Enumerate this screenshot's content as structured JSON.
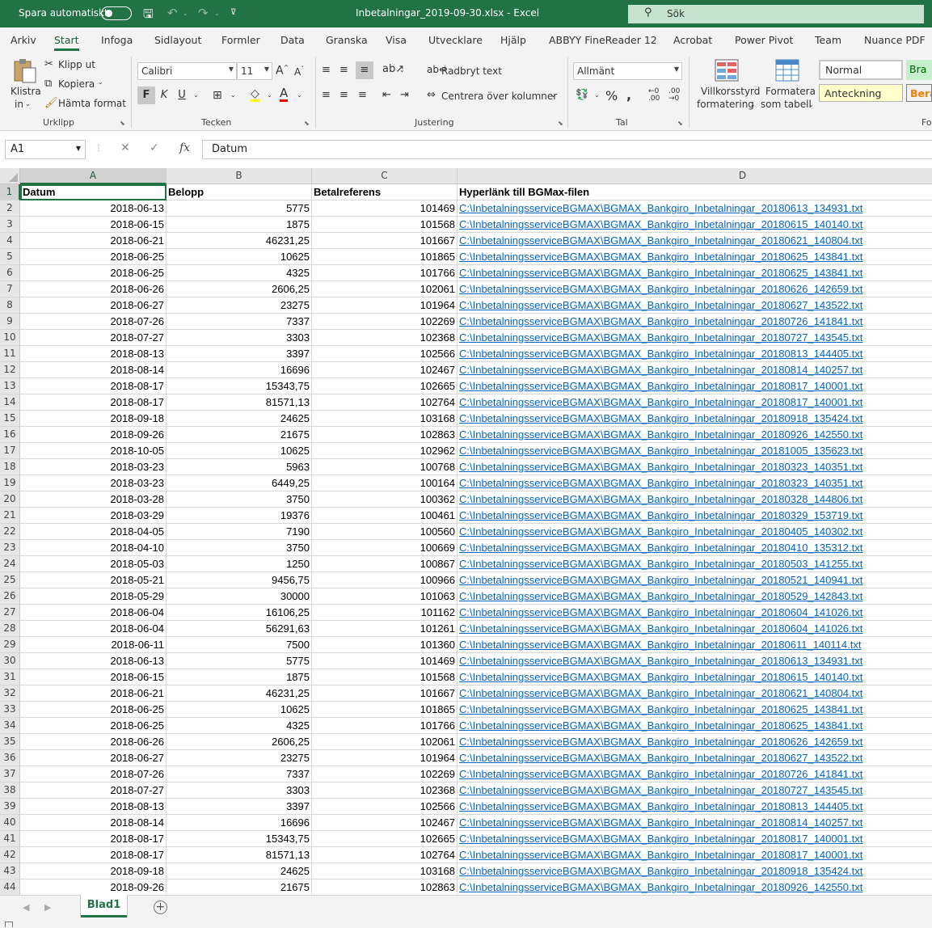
{
  "titlebar": {
    "autosave_label": "Spara automatiskt",
    "window_title": "Inbetalningar_2019-09-30.xlsx  -  Excel",
    "search_label": "Sök"
  },
  "tabs": [
    "Arkiv",
    "Start",
    "Infoga",
    "Sidlayout",
    "Formler",
    "Data",
    "Granska",
    "Visa",
    "Utvecklare",
    "Hjälp",
    "ABBYY FineReader 12",
    "Acrobat",
    "Power Pivot",
    "Team",
    "Nuance PDF"
  ],
  "ribbon": {
    "clipboard": {
      "paste_line1": "Klistra",
      "paste_line2": "in",
      "cut": "Klipp ut",
      "copy": "Kopiera",
      "format_painter": "Hämta format",
      "group": "Urklipp"
    },
    "font": {
      "name": "Calibri",
      "size": "11",
      "bold": "F",
      "italic": "K",
      "underline": "U",
      "group": "Tecken"
    },
    "alignment": {
      "wrap": "Radbryt text",
      "merge": "Centrera över kolumner",
      "group": "Justering"
    },
    "number": {
      "format": "Allmänt",
      "group": "Tal"
    },
    "styles": {
      "conditional_line1": "Villkorsstyrd",
      "conditional_line2": "formatering",
      "table_line1": "Formatera",
      "table_line2": "som tabell",
      "normal": "Normal",
      "good": "Bra",
      "note": "Anteckning",
      "calc": "Beräkning",
      "group": "Fo"
    }
  },
  "formula_bar": {
    "name_box": "A1",
    "fx": "fx",
    "content": "Datum"
  },
  "columns": [
    "A",
    "B",
    "C",
    "D"
  ],
  "header_row": [
    "Datum",
    "Belopp",
    "Betalreferens",
    "Hyperlänk till BGMax-filen"
  ],
  "rows": [
    [
      "2018-06-13",
      "5775",
      "101469",
      "C:\\InbetalningsserviceBGMAX\\BGMAX_Bankgiro_Inbetalningar_20180613_134931.txt"
    ],
    [
      "2018-06-15",
      "1875",
      "101568",
      "C:\\InbetalningsserviceBGMAX\\BGMAX_Bankgiro_Inbetalningar_20180615_140140.txt"
    ],
    [
      "2018-06-21",
      "46231,25",
      "101667",
      "C:\\InbetalningsserviceBGMAX\\BGMAX_Bankgiro_Inbetalningar_20180621_140804.txt"
    ],
    [
      "2018-06-25",
      "10625",
      "101865",
      "C:\\InbetalningsserviceBGMAX\\BGMAX_Bankgiro_Inbetalningar_20180625_143841.txt"
    ],
    [
      "2018-06-25",
      "4325",
      "101766",
      "C:\\InbetalningsserviceBGMAX\\BGMAX_Bankgiro_Inbetalningar_20180625_143841.txt"
    ],
    [
      "2018-06-26",
      "2606,25",
      "102061",
      "C:\\InbetalningsserviceBGMAX\\BGMAX_Bankgiro_Inbetalningar_20180626_142659.txt"
    ],
    [
      "2018-06-27",
      "23275",
      "101964",
      "C:\\InbetalningsserviceBGMAX\\BGMAX_Bankgiro_Inbetalningar_20180627_143522.txt"
    ],
    [
      "2018-07-26",
      "7337",
      "102269",
      "C:\\InbetalningsserviceBGMAX\\BGMAX_Bankgiro_Inbetalningar_20180726_141841.txt"
    ],
    [
      "2018-07-27",
      "3303",
      "102368",
      "C:\\InbetalningsserviceBGMAX\\BGMAX_Bankgiro_Inbetalningar_20180727_143545.txt"
    ],
    [
      "2018-08-13",
      "3397",
      "102566",
      "C:\\InbetalningsserviceBGMAX\\BGMAX_Bankgiro_Inbetalningar_20180813_144405.txt"
    ],
    [
      "2018-08-14",
      "16696",
      "102467",
      "C:\\InbetalningsserviceBGMAX\\BGMAX_Bankgiro_Inbetalningar_20180814_140257.txt"
    ],
    [
      "2018-08-17",
      "15343,75",
      "102665",
      "C:\\InbetalningsserviceBGMAX\\BGMAX_Bankgiro_Inbetalningar_20180817_140001.txt"
    ],
    [
      "2018-08-17",
      "81571,13",
      "102764",
      "C:\\InbetalningsserviceBGMAX\\BGMAX_Bankgiro_Inbetalningar_20180817_140001.txt"
    ],
    [
      "2018-09-18",
      "24625",
      "103168",
      "C:\\InbetalningsserviceBGMAX\\BGMAX_Bankgiro_Inbetalningar_20180918_135424.txt"
    ],
    [
      "2018-09-26",
      "21675",
      "102863",
      "C:\\InbetalningsserviceBGMAX\\BGMAX_Bankgiro_Inbetalningar_20180926_142550.txt"
    ],
    [
      "2018-10-05",
      "10625",
      "102962",
      "C:\\InbetalningsserviceBGMAX\\BGMAX_Bankgiro_Inbetalningar_20181005_135623.txt"
    ],
    [
      "2018-03-23",
      "5963",
      "100768",
      "C:\\InbetalningsserviceBGMAX\\BGMAX_Bankgiro_Inbetalningar_20180323_140351.txt"
    ],
    [
      "2018-03-23",
      "6449,25",
      "100164",
      "C:\\InbetalningsserviceBGMAX\\BGMAX_Bankgiro_Inbetalningar_20180323_140351.txt"
    ],
    [
      "2018-03-28",
      "3750",
      "100362",
      "C:\\InbetalningsserviceBGMAX\\BGMAX_Bankgiro_Inbetalningar_20180328_144806.txt"
    ],
    [
      "2018-03-29",
      "19376",
      "100461",
      "C:\\InbetalningsserviceBGMAX\\BGMAX_Bankgiro_Inbetalningar_20180329_153719.txt"
    ],
    [
      "2018-04-05",
      "7190",
      "100560",
      "C:\\InbetalningsserviceBGMAX\\BGMAX_Bankgiro_Inbetalningar_20180405_140302.txt"
    ],
    [
      "2018-04-10",
      "3750",
      "100669",
      "C:\\InbetalningsserviceBGMAX\\BGMAX_Bankgiro_Inbetalningar_20180410_135312.txt"
    ],
    [
      "2018-05-03",
      "1250",
      "100867",
      "C:\\InbetalningsserviceBGMAX\\BGMAX_Bankgiro_Inbetalningar_20180503_141255.txt"
    ],
    [
      "2018-05-21",
      "9456,75",
      "100966",
      "C:\\InbetalningsserviceBGMAX\\BGMAX_Bankgiro_Inbetalningar_20180521_140941.txt"
    ],
    [
      "2018-05-29",
      "30000",
      "101063",
      "C:\\InbetalningsserviceBGMAX\\BGMAX_Bankgiro_Inbetalningar_20180529_142843.txt"
    ],
    [
      "2018-06-04",
      "16106,25",
      "101162",
      "C:\\InbetalningsserviceBGMAX\\BGMAX_Bankgiro_Inbetalningar_20180604_141026.txt"
    ],
    [
      "2018-06-04",
      "56291,63",
      "101261",
      "C:\\InbetalningsserviceBGMAX\\BGMAX_Bankgiro_Inbetalningar_20180604_141026.txt"
    ],
    [
      "2018-06-11",
      "7500",
      "101360",
      "C:\\InbetalningsserviceBGMAX\\BGMAX_Bankgiro_Inbetalningar_20180611_140114.txt"
    ],
    [
      "2018-06-13",
      "5775",
      "101469",
      "C:\\InbetalningsserviceBGMAX\\BGMAX_Bankgiro_Inbetalningar_20180613_134931.txt"
    ],
    [
      "2018-06-15",
      "1875",
      "101568",
      "C:\\InbetalningsserviceBGMAX\\BGMAX_Bankgiro_Inbetalningar_20180615_140140.txt"
    ],
    [
      "2018-06-21",
      "46231,25",
      "101667",
      "C:\\InbetalningsserviceBGMAX\\BGMAX_Bankgiro_Inbetalningar_20180621_140804.txt"
    ],
    [
      "2018-06-25",
      "10625",
      "101865",
      "C:\\InbetalningsserviceBGMAX\\BGMAX_Bankgiro_Inbetalningar_20180625_143841.txt"
    ],
    [
      "2018-06-25",
      "4325",
      "101766",
      "C:\\InbetalningsserviceBGMAX\\BGMAX_Bankgiro_Inbetalningar_20180625_143841.txt"
    ],
    [
      "2018-06-26",
      "2606,25",
      "102061",
      "C:\\InbetalningsserviceBGMAX\\BGMAX_Bankgiro_Inbetalningar_20180626_142659.txt"
    ],
    [
      "2018-06-27",
      "23275",
      "101964",
      "C:\\InbetalningsserviceBGMAX\\BGMAX_Bankgiro_Inbetalningar_20180627_143522.txt"
    ],
    [
      "2018-07-26",
      "7337",
      "102269",
      "C:\\InbetalningsserviceBGMAX\\BGMAX_Bankgiro_Inbetalningar_20180726_141841.txt"
    ],
    [
      "2018-07-27",
      "3303",
      "102368",
      "C:\\InbetalningsserviceBGMAX\\BGMAX_Bankgiro_Inbetalningar_20180727_143545.txt"
    ],
    [
      "2018-08-13",
      "3397",
      "102566",
      "C:\\InbetalningsserviceBGMAX\\BGMAX_Bankgiro_Inbetalningar_20180813_144405.txt"
    ],
    [
      "2018-08-14",
      "16696",
      "102467",
      "C:\\InbetalningsserviceBGMAX\\BGMAX_Bankgiro_Inbetalningar_20180814_140257.txt"
    ],
    [
      "2018-08-17",
      "15343,75",
      "102665",
      "C:\\InbetalningsserviceBGMAX\\BGMAX_Bankgiro_Inbetalningar_20180817_140001.txt"
    ],
    [
      "2018-08-17",
      "81571,13",
      "102764",
      "C:\\InbetalningsserviceBGMAX\\BGMAX_Bankgiro_Inbetalningar_20180817_140001.txt"
    ],
    [
      "2018-09-18",
      "24625",
      "103168",
      "C:\\InbetalningsserviceBGMAX\\BGMAX_Bankgiro_Inbetalningar_20180918_135424.txt"
    ],
    [
      "2018-09-26",
      "21675",
      "102863",
      "C:\\InbetalningsserviceBGMAX\\BGMAX_Bankgiro_Inbetalningar_20180926_142550.txt"
    ]
  ],
  "sheet": {
    "tab": "Blad1",
    "add": "+"
  },
  "colors": {
    "accent": "#217346",
    "link": "#0563c1"
  }
}
